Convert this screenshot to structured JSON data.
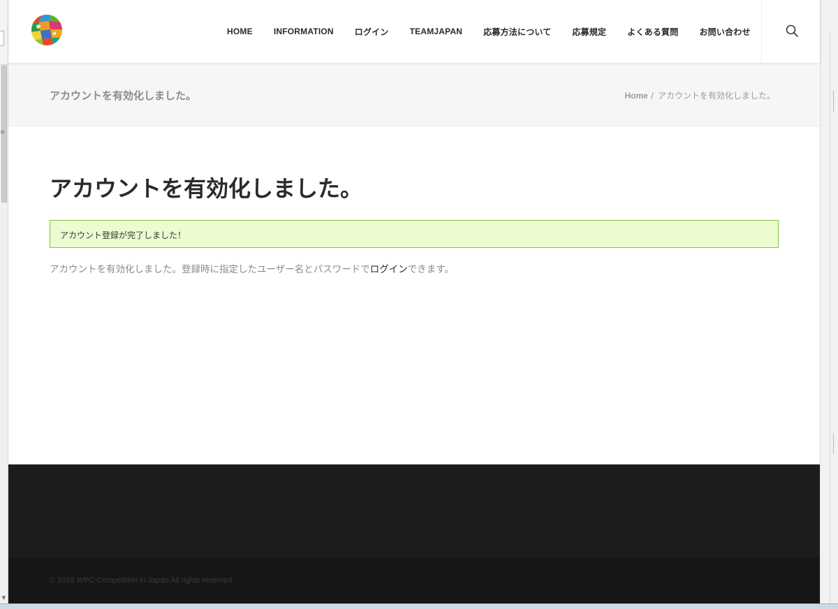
{
  "colors": {
    "header_bg": "#ffffff",
    "title_bar_bg": "#f6f6f6",
    "notice_bg": "#eafcd0",
    "notice_border": "#7fc33a",
    "footer_bg": "#1c1c1e",
    "footer_bottom_bg": "#161618",
    "heading_text": "#2b2b2b",
    "muted_text": "#8a8a8a"
  },
  "header": {
    "logo_icon": "colorful-mosaic-circle-logo",
    "nav": [
      {
        "label": "HOME"
      },
      {
        "label": "INFORMATION"
      },
      {
        "label": "ログイン"
      },
      {
        "label": "TEAMJAPAN"
      },
      {
        "label": "応募方法について"
      },
      {
        "label": "応募規定"
      },
      {
        "label": "よくある質問"
      },
      {
        "label": "お問い合わせ"
      }
    ],
    "search_icon": "search-icon"
  },
  "title_bar": {
    "title": "アカウントを有効化しました。",
    "breadcrumb": {
      "home": "Home",
      "separator": "/",
      "current": "アカウントを有効化しました。"
    }
  },
  "main": {
    "heading": "アカウントを有効化しました。",
    "notice": "アカウント登録が完了しました！",
    "message_before": "アカウントを有効化しました。登録時に指定したユーザー名とパスワードで",
    "message_link": "ログイン",
    "message_after": "できます。"
  },
  "footer": {
    "copyright": "© 2018 WPC Competition in Japan All rights reserved."
  }
}
